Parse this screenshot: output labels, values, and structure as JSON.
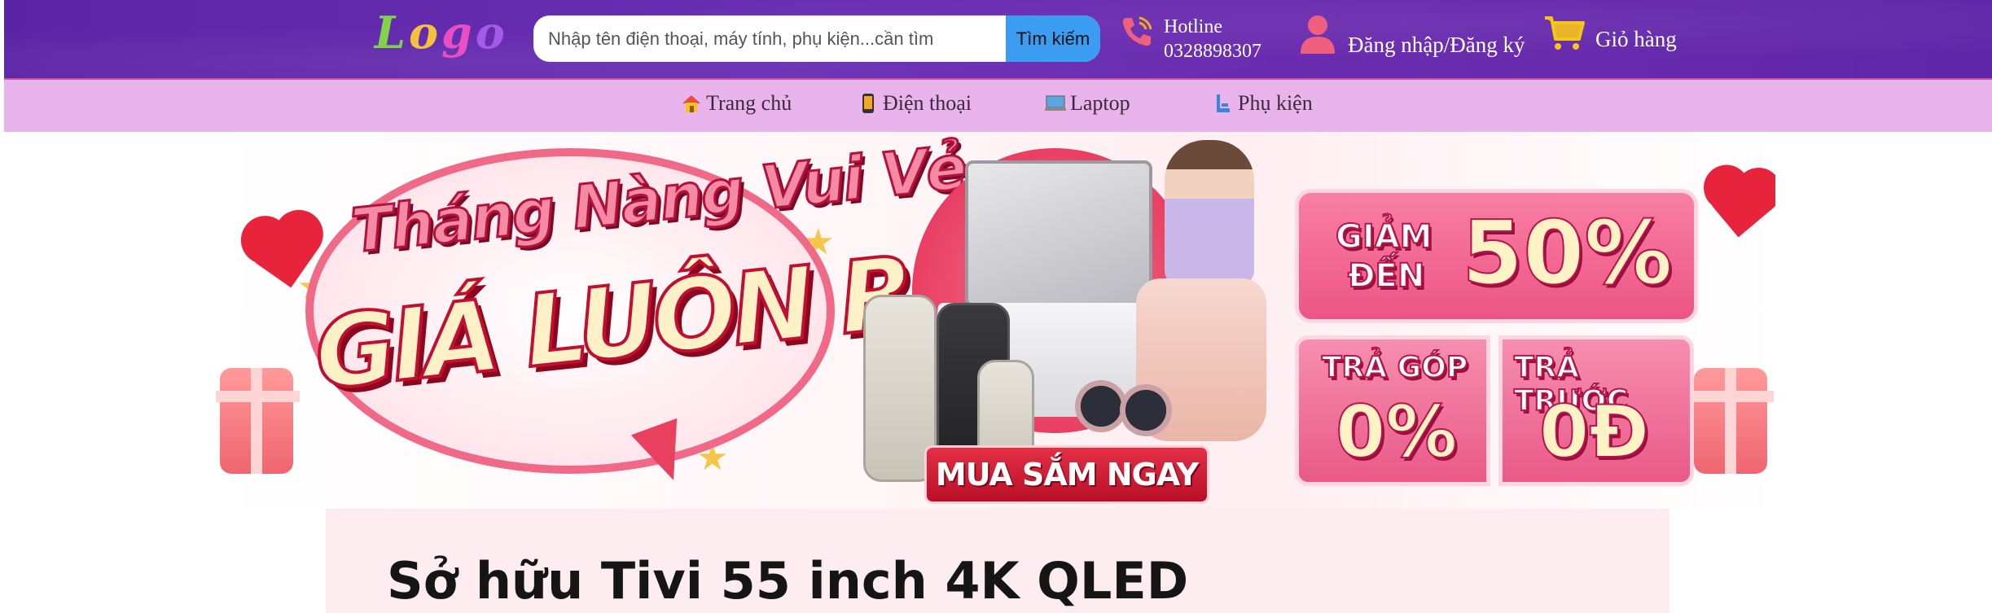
{
  "header": {
    "logo": [
      "L",
      "o",
      "g",
      "o"
    ],
    "search": {
      "placeholder": "Nhập tên điện thoại, máy tính, phụ kiện...cần tìm",
      "button_label": "Tìm kiếm"
    },
    "hotline": {
      "label": "Hotline",
      "number": "0328898307",
      "icon": "phone-icon"
    },
    "account": {
      "label": "Đăng nhập/Đăng ký",
      "icon": "user-icon"
    },
    "cart": {
      "label": "Giỏ hàng",
      "icon": "cart-icon"
    }
  },
  "nav": {
    "items": [
      {
        "label": "Trang chủ",
        "icon": "home-icon"
      },
      {
        "label": "Điện thoại",
        "icon": "mobile-icon"
      },
      {
        "label": "Laptop",
        "icon": "laptop-icon"
      },
      {
        "label": "Phụ kiện",
        "icon": "accessory-icon"
      }
    ]
  },
  "banner": {
    "headline_1": "Tháng Nàng Vui Vẻ",
    "headline_2": "GIÁ LUÔN RẺ",
    "cta": "MUA SẮM NGAY",
    "discount_prefix_1": "GIẢM",
    "discount_prefix_2": "ĐẾN",
    "discount_value": "50%",
    "installment_label": "TRẢ GÓP",
    "installment_value": "0%",
    "prepay_label": "TRẢ TRƯỚC",
    "prepay_value": "0Đ"
  },
  "section": {
    "title": "Sở hữu Tivi 55 inch 4K QLED"
  },
  "colors": {
    "header_bg": "#6a2fb4",
    "nav_bg": "#e9b4ec",
    "search_button": "#3a9df2",
    "icon_pink": "#f0607e",
    "cart_yellow": "#f5c518"
  }
}
